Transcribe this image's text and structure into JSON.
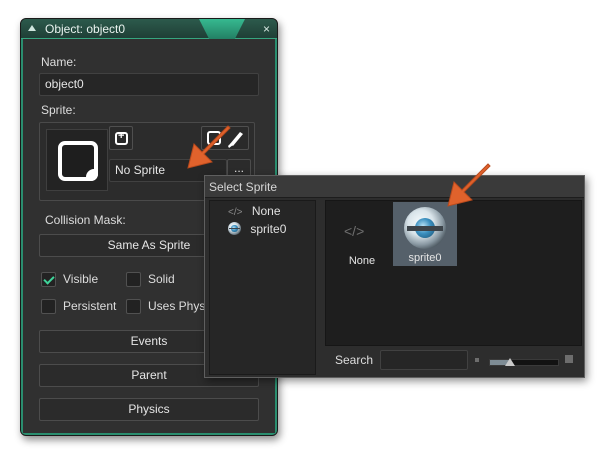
{
  "object_window": {
    "title": "Object: object0",
    "close_glyph": "×",
    "name_label": "Name:",
    "name_value": "object0",
    "sprite_label": "Sprite:",
    "sprite_value": "No Sprite",
    "browse_glyph": "...",
    "collision_mask_label": "Collision Mask:",
    "collision_mask_value": "Same As Sprite",
    "checkboxes": {
      "visible": {
        "label": "Visible",
        "checked": true
      },
      "solid": {
        "label": "Solid",
        "checked": false
      },
      "persistent": {
        "label": "Persistent",
        "checked": false
      },
      "uses_physics": {
        "label": "Uses Phys",
        "checked": false
      }
    },
    "buttons": {
      "events": "Events",
      "parent": "Parent",
      "physics": "Physics"
    }
  },
  "select_sprite_popup": {
    "title": "Select Sprite",
    "tree": [
      {
        "icon": "code-brackets-icon",
        "glyph": "</>",
        "label": "None"
      },
      {
        "icon": "sprite-sphere-icon",
        "label": "sprite0"
      }
    ],
    "grid": [
      {
        "icon": "code-brackets-icon",
        "glyph": "</>",
        "label": "None",
        "selected": false
      },
      {
        "icon": "sprite-sphere-icon",
        "label": "sprite0",
        "selected": true
      }
    ],
    "search_label": "Search",
    "search_value": "",
    "zoom_level": 0.3
  },
  "colors": {
    "accent_green": "#36a680",
    "annotation_arrow": "#e0622c",
    "panel_bg": "#303030"
  }
}
